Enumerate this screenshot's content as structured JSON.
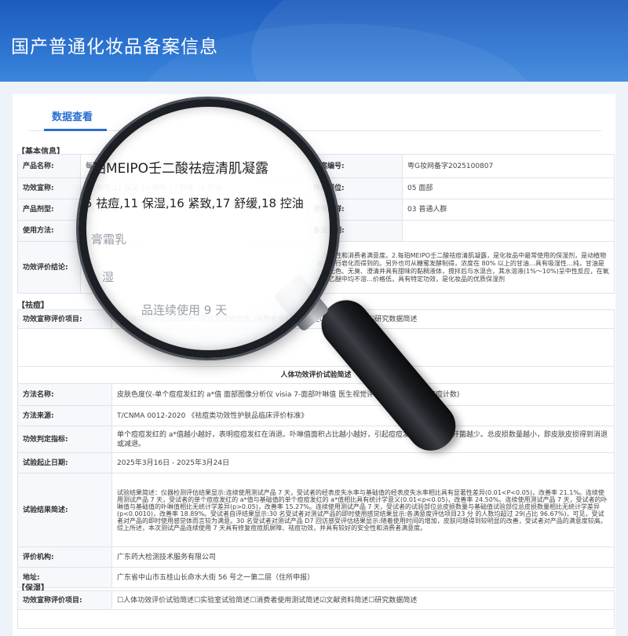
{
  "header": {
    "title": "国产普通化妆品备案信息"
  },
  "tabs": [
    {
      "label": "数据查看"
    }
  ],
  "basic": {
    "section_title": "【基本信息】",
    "product_name_label": "产品名称:",
    "product_name": "每珀MEIPO壬二酸祛痘清肌凝露",
    "record_no_label": "备案编号:",
    "record_no": "粤G妆网备字2025100807",
    "efficacy_label": "功效宣称:",
    "efficacy": "05 祛痘,11 保湿,16 紧致,17 舒缓,18 控油",
    "site_label": "作用部位:",
    "site": "05 面部",
    "form_label": "产品剂型:",
    "form": "05 膏霜乳",
    "group_label": "使用人群:",
    "group": "03 普通人群",
    "method_label": "使用方法:",
    "method": "",
    "note_label": "备注说明:",
    "note": "",
    "conclusion_label": "功效评价结论:",
    "conclusion": "…安全性和消费者满意度。2.每珀MEIPO壬二酸祛痘清肌凝露，是化妆品中最常使用的保湿剂，是动植物油脂进行皂化而得到的。另外也可从糖蜜发酵制得，浓度在 80% 以上的甘油…具有吸湿性…纯，甘油是一种无色、无臭、澄清并具有甜味的黏稠液体，搅拌后与水混合，其水溶液(1%～10%)呈中性反应，在氧仿或乙醚中均不溶…价格低，具有特定功效，是化妆品的优质保湿剂"
  },
  "acne": {
    "section_title": "【祛痘】",
    "claim_label": "功效宣称评价项目:",
    "claim_options": "☑人体功效评价试验简述☐实验室试验简述☐消费者使用测试简述☐文献资料简述☐研究数据简述",
    "caption": "人体功效评价试验简述",
    "method_label": "方法名称:",
    "method": "皮肤色度仪-单个痘痘发红的 a*值 面部图像分析仪 visia 7-面部叶啉值 医生视觉评估-面部痘痘数量(痘痘计数)",
    "source_label": "方法来源:",
    "source": "T/CNMA 0012-2020 《祛痘类功效性护肤品临床评价标准》",
    "criteria_label": "功效判定指标:",
    "criteria": "单个痘痘发红的 a*值越小越好，表明痘痘发红在消退。卟啉值面积占比越小越好，引起痘痘发红的痤疮丙酸杆菌越少。总皮损数量越小，即皮肤皮损得到消退或减退。",
    "dates_label": "试验起止日期:",
    "dates": "2025年3月16日 - 2025年3月24日",
    "result_label": "试验结果简述:",
    "result": "试验结果简述：仪器检测评估结果显示:连续使用测试产品 7 天，受试者的经表皮失水率与基础值的经表皮失水率相比具有显著性差异(0.01<P<0.05)，改善率 21.1%。连续使用测试产品 7 天，受试者的单个痘痘发红的 a*值与基础值的单个痘痘发红的 a*值相比具有统计学意义(0.01<p<0.05)，改善率 24.50%。连续使用测试产品 7 天，受试者的卟啉值与基础值的卟啉值相比无统计学差异(p>0.05)，改善率 15.27%。连续使用测试产品 7 天，受试者的试验部位总皮损数量与基础值试验部位总皮损数量相比无统计学差异(p<0.0010)，改善率 18.89%。受试者自评结果显示:30 名受试者对测试产品的即时使用感觉结果显示:各满意度评估项目23 分 的人数均超过 29(占比 96.67%)，可见，受试者对产品的即时使用感觉体而言较为满意。30 名受试者对测试产品 D7 回访感受评估结果显示:随着使用时间的增加，皮肤问题得到较明显的改善，受试者对产品的满意度较高。综上所述，本次测试产品连续使用 7 天具有修复痘痘肌屏障、祛痘功效，并具有较好的安全性和消费者满意度。",
    "org_label": "评价机构:",
    "org": "广东药大检测技术服务有限公司",
    "address_label": "地址:",
    "address": "广东省中山市五桂山长命水大街 56 号之一第二层（住所申报）"
  },
  "moist": {
    "section_title": "【保湿】",
    "claim_label": "功效宣称评价项目:",
    "claim_options": "☐人体功效评价试验简述☐实验室试验简述☐消费者使用测试简述☑文献资料简述☐研究数据简述"
  },
  "lens": {
    "line1": "珀MEIPO壬二酸祛痘清肌凝露",
    "line2": "5 祛痘,11 保湿,16 紧致,17 舒缓,18 控油",
    "line3": "膏霜乳",
    "line4": "湿",
    "line5": "品连续使用 9 天"
  }
}
